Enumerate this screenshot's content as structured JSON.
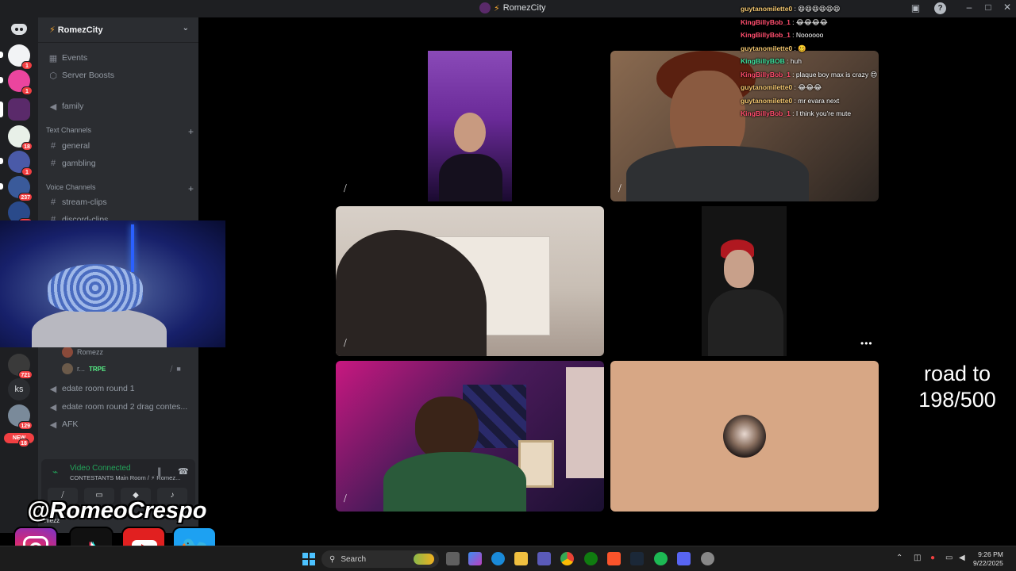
{
  "window": {
    "title": "RomezCity",
    "title_prefix": "⚡"
  },
  "server": {
    "name": "RomezCity",
    "prefix": "⚡"
  },
  "rail_badges": [
    "1",
    "1",
    "18",
    "1",
    "237",
    "140",
    "721",
    "129",
    "18"
  ],
  "rail_new": "NEW",
  "rail_ks": "ks",
  "sidebar": {
    "events": "Events",
    "boosts": "Server Boosts",
    "family": "family",
    "text_category": "Text Channels",
    "text_channels": [
      "general",
      "gambling"
    ],
    "voice_category": "Voice Channels",
    "voice_channels_top": [
      "stream-clips",
      "discord-clips"
    ],
    "user_romezz": "Romezz",
    "user_r": "r...",
    "user_tag": "TRPE",
    "voice_channels_bottom": [
      "edate room round 1",
      "edate room round 2 drag contes...",
      "AFK"
    ]
  },
  "voice_panel": {
    "status": "Video Connected",
    "location": "CONTESTANTS Main Room / ⚡ Romez...",
    "user_label": "mezz"
  },
  "chat": [
    {
      "user": "guytanomilette0",
      "color": "#f2c66f",
      "msg": "😆😆😆😆😆😆"
    },
    {
      "user": "KingBillyBob_1",
      "color": "#ff4d6d",
      "msg": "😂😂😂😂"
    },
    {
      "user": "KingBillyBob_1",
      "color": "#ff4d6d",
      "msg": "Noooooo"
    },
    {
      "user": "guytanomilette0",
      "color": "#f2c66f",
      "msg": "🥴"
    },
    {
      "user": "KingBillyBOB",
      "color": "#3ee4a0",
      "msg": "huh"
    },
    {
      "user": "KingBillyBob_1",
      "color": "#ff4d6d",
      "msg": "plaque boy max is crazy 😍"
    },
    {
      "user": "guytanomilette0",
      "color": "#f2c66f",
      "msg": "😂😂😂"
    },
    {
      "user": "guytanomilette0",
      "color": "#f2c66f",
      "msg": "mr evara next"
    },
    {
      "user": "KingBillyBob_1",
      "color": "#ff4d6d",
      "msg": "I think you're mute"
    }
  ],
  "overlay": {
    "road_line1": "road to",
    "road_line2": "198/500",
    "handle": "@RomeoCrespo"
  },
  "taskbar": {
    "search_placeholder": "Search",
    "time": "9:26 PM",
    "date": "9/22/2025"
  },
  "colors": {
    "discord_bg": "#2b2d31",
    "rail_bg": "#1e1f22",
    "connected_green": "#23a55a",
    "badge_red": "#f23f42",
    "avatar_tile": "#d7a785"
  }
}
